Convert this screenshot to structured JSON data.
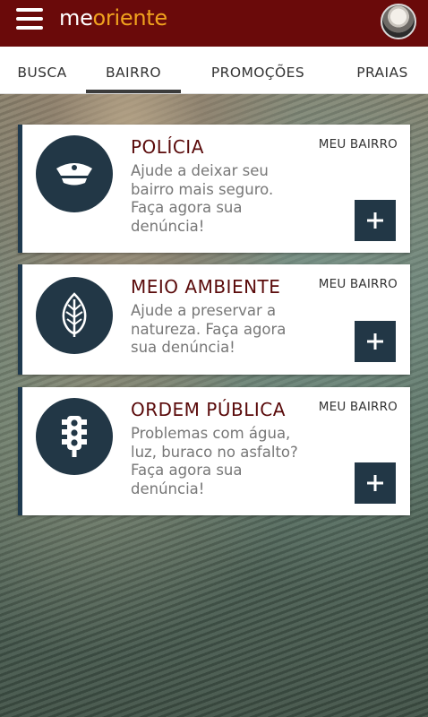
{
  "header": {
    "brand_prefix": "me",
    "brand_suffix": "oriente",
    "menu_icon": "hamburger-menu-icon",
    "avatar": "user-avatar"
  },
  "tabs": [
    {
      "label": "BUSCA",
      "active": false
    },
    {
      "label": "BAIRRO",
      "active": true
    },
    {
      "label": "PROMOÇÕES",
      "active": false
    },
    {
      "label": "PRAIAS",
      "active": false
    }
  ],
  "cards": [
    {
      "title": "POLÍCIA",
      "scope": "MEU BAIRRO",
      "description": "Ajude a deixar seu bairro mais seguro. Faça agora sua denúncia!",
      "icon": "police-cap-icon",
      "action": "+"
    },
    {
      "title": "MEIO AMBIENTE",
      "scope": "MEU BAIRRO",
      "description": "Ajude a preservar a natureza. Faça agora sua denúncia!",
      "icon": "leaf-icon",
      "action": "+"
    },
    {
      "title": "ORDEM PÚBLICA",
      "scope": "MEU BAIRRO",
      "description": "Problemas com água, luz, buraco no asfalto? Faça agora sua denúncia!",
      "icon": "traffic-light-icon",
      "action": "+"
    }
  ],
  "colors": {
    "topbar": "#6a0a0a",
    "brand_accent": "#f0a21e",
    "card_accent": "#223746",
    "title": "#5a0a0a"
  }
}
